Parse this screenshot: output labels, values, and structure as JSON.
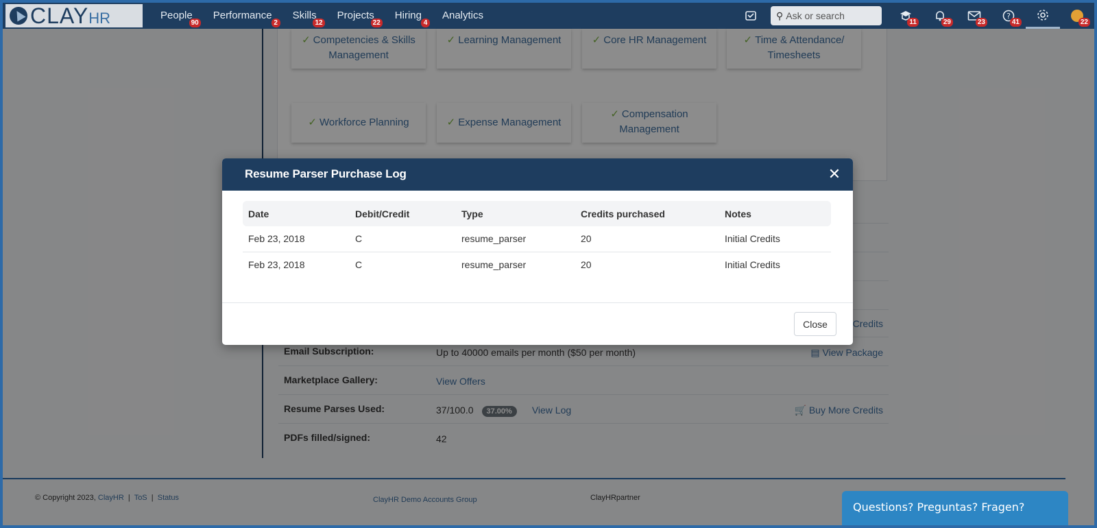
{
  "app": {
    "logo_main": "CLAY",
    "logo_sub": "HR"
  },
  "nav": [
    {
      "label": "People",
      "badge": "90"
    },
    {
      "label": "Performance",
      "badge": "2"
    },
    {
      "label": "Skills",
      "badge": "12"
    },
    {
      "label": "Projects",
      "badge": "22"
    },
    {
      "label": "Hiring",
      "badge": "4"
    },
    {
      "label": "Analytics",
      "badge": ""
    }
  ],
  "topright": {
    "search_placeholder": "Ask or search",
    "badges": {
      "courses": "11",
      "notifications": "29",
      "messages": "23",
      "help": "41",
      "profile": "22"
    }
  },
  "tiles": [
    "Competencies & Skills Management",
    "Learning Management",
    "Core HR Management",
    "Time & Attendance/ Timesheets",
    "Workforce Planning",
    "Expense Management",
    "Compensation Management"
  ],
  "info": {
    "credits_link": "Credits",
    "email_label": "Email Subscription:",
    "email_value": "Up to 40000 emails per month ($50 per month)",
    "email_action": "View Package",
    "market_label": "Marketplace Gallery:",
    "market_value": "View Offers",
    "resume_label": "Resume Parses Used:",
    "resume_value": "37/100.0",
    "resume_pct": "37.00%",
    "resume_log": "View Log",
    "resume_action": "Buy More Credits",
    "pdf_label": "PDFs filled/signed:",
    "pdf_value": "42"
  },
  "footer": {
    "copyright": "© Copyright 2023,",
    "company": "ClayHR",
    "tos": "ToS",
    "status": "Status",
    "group": "ClayHR Demo Accounts Group",
    "partner": "ClayHRpartner",
    "help": "Questions? Preguntas? Fragen?"
  },
  "modal": {
    "title": "Resume Parser Purchase Log",
    "close_label": "Close",
    "columns": [
      "Date",
      "Debit/Credit",
      "Type",
      "Credits purchased",
      "Notes"
    ],
    "rows": [
      [
        "Feb 23, 2018",
        "C",
        "resume_parser",
        "20",
        "Initial Credits"
      ],
      [
        "Feb 23, 2018",
        "C",
        "resume_parser",
        "20",
        "Initial Credits"
      ]
    ]
  },
  "colors": {
    "nav_bg": "#1e3d5f",
    "accent": "#3d6d9e",
    "badge": "#c92a2a",
    "check": "#7cb342"
  }
}
